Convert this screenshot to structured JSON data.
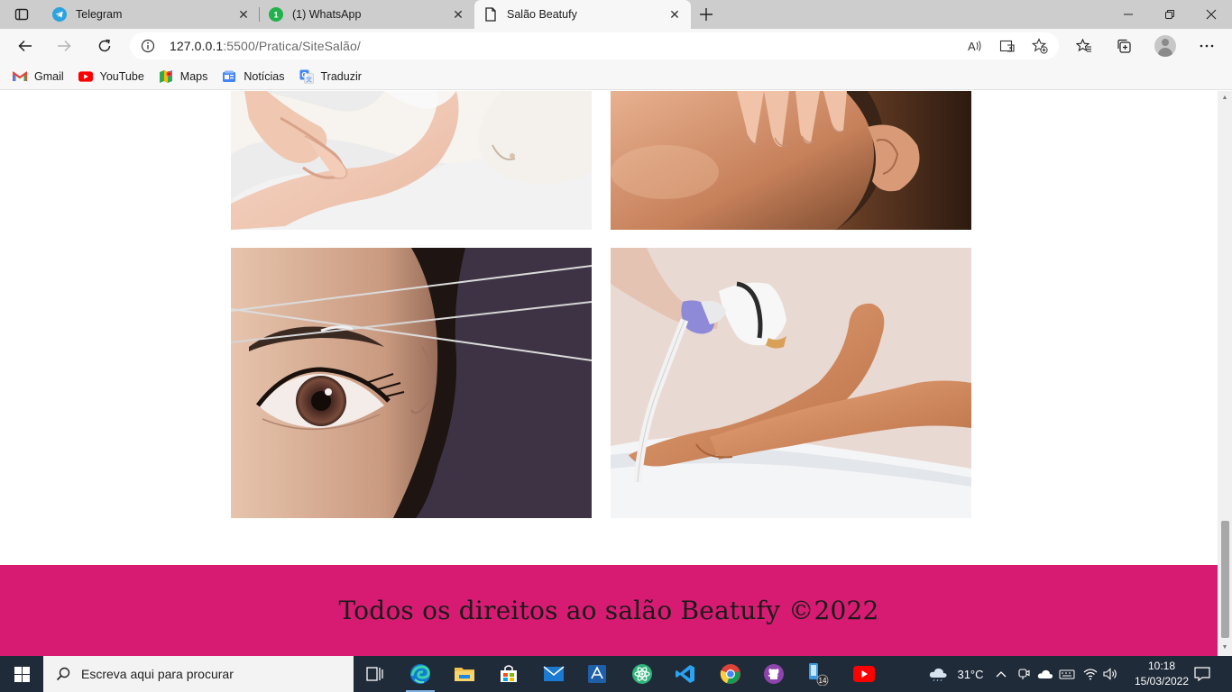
{
  "browser": {
    "tabs": [
      {
        "label": "Telegram",
        "icon": "telegram-icon",
        "close": "✕"
      },
      {
        "label": "(1) WhatsApp",
        "icon": "whatsapp-icon",
        "close": "✕"
      },
      {
        "label": "Salão Beatufy",
        "icon": "page-icon",
        "close": "✕"
      }
    ],
    "address": {
      "host": "127.0.0.1",
      "path": ":5500/Pratica/SiteSalão/"
    },
    "bookmarks": [
      {
        "label": "Gmail",
        "icon": "gmail-icon"
      },
      {
        "label": "YouTube",
        "icon": "youtube-icon"
      },
      {
        "label": "Maps",
        "icon": "maps-icon"
      },
      {
        "label": "Notícias",
        "icon": "news-icon"
      },
      {
        "label": "Traduzir",
        "icon": "translate-icon"
      }
    ]
  },
  "page": {
    "images": [
      {
        "name": "facial-mask-image"
      },
      {
        "name": "massage-image"
      },
      {
        "name": "eyebrow-threading-image"
      },
      {
        "name": "laser-hair-removal-image"
      }
    ],
    "footer": {
      "text": "Todos os direitos ao salão Beatufy ©2022",
      "color": "#d81b72"
    }
  },
  "taskbar": {
    "search_placeholder": "Escreva aqui para procurar",
    "weather": "31°C",
    "time": "10:18",
    "date": "15/03/2022",
    "badge": "14"
  }
}
